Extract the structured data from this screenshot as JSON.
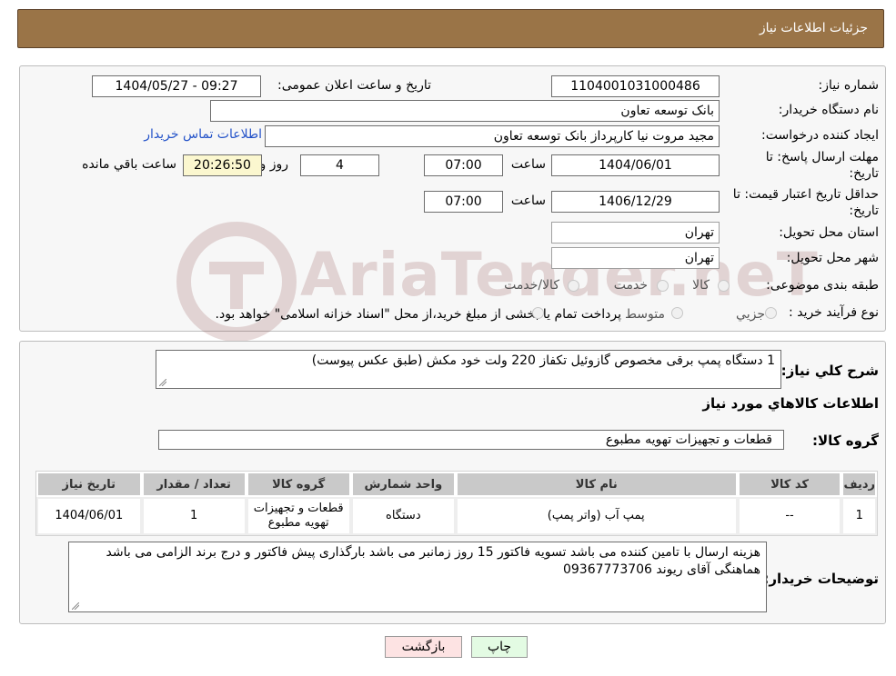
{
  "header": {
    "title": "جزئیات اطلاعات نیاز"
  },
  "labels": {
    "need_number": "شماره نیاز:",
    "announce_datetime": "تاریخ و ساعت اعلان عمومی:",
    "buyer_name": "نام دستگاه خریدار:",
    "requester": "ایجاد کننده درخواست:",
    "reply_deadline_1": "مهلت ارسال پاسخ: تا",
    "reply_deadline_2": "تاریخ:",
    "hour": "ساعت",
    "days": "روز و",
    "remaining": "ساعت باقي مانده",
    "price_validity_1": "حداقل تاریخ اعتبار قیمت: تا",
    "price_validity_2": "تاریخ:",
    "province": "استان محل تحویل:",
    "city": "شهر محل تحویل:",
    "category": "طبقه بندی موضوعی:",
    "process_type": "نوع فرآیند خرید :",
    "description": "شرح کلي نیاز:",
    "goods_info": "اطلاعات کالاهاي مورد نیاز",
    "goods_group": "گروه کالا:",
    "buyer_notes": "توضیحات خریدار:"
  },
  "values": {
    "need_number": "1104001031000486",
    "announce_datetime": "1404/05/27 - 09:27",
    "buyer_name": "بانک توسعه تعاون",
    "requester": "مجید مروت نیا کارپرداز بانک توسعه تعاون",
    "contact_link": "اطلاعات تماس خریدار",
    "reply_date": "1404/06/01",
    "reply_time": "07:00",
    "reply_days": "4",
    "reply_remaining": "20:26:50",
    "validity_date": "1406/12/29",
    "validity_time": "07:00",
    "province": "تهران",
    "city": "تهران",
    "description": "1 دستگاه پمپ برقی مخصوص گازوئیل تکفاز 220 ولت خود مکش (طبق عکس پیوست)",
    "goods_group": "قطعات و تجهیزات تهویه مطبوع",
    "buyer_notes_line1": "هزینه ارسال با تامین کننده می باشد تسویه فاکتور 15 روز زمانبر می باشد بارگذاری پیش فاکتور و درج برند الزامی می باشد",
    "buyer_notes_line2": "هماهنگی آقای ریوند 09367773706"
  },
  "category_options": [
    "کالا",
    "خدمت",
    "کالا/خدمت"
  ],
  "process_options": [
    "جزیي",
    "متوسط"
  ],
  "process_note": "پرداخت تمام یا بخشی از مبلغ خرید،از محل \"اسناد خزانه اسلامی\" خواهد بود.",
  "table": {
    "headers": [
      "ردیف",
      "کد کالا",
      "نام کالا",
      "واحد شمارش",
      "گروه کالا",
      "تعداد / مقدار",
      "تاریخ نیاز"
    ],
    "rows": [
      [
        "1",
        "--",
        "پمپ آب (واتر پمپ)",
        "دستگاه",
        "قطعات و تجهیزات تهویه مطبوع",
        "1",
        "1404/06/01"
      ]
    ]
  },
  "buttons": {
    "back": "بازگشت",
    "print": "چاپ"
  },
  "watermark": {
    "text": "AriaTender.neT"
  },
  "colors": {
    "header_bg": "#9a7447",
    "link": "#2453c9",
    "remaining_bg": "#fbf7cf",
    "back_bg": "#fde3e3",
    "print_bg": "#e3fbe3"
  }
}
